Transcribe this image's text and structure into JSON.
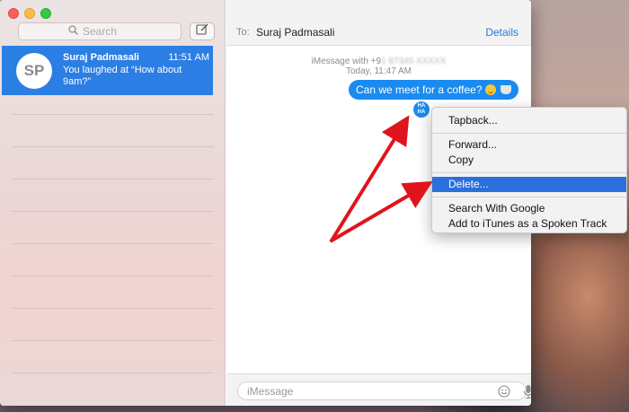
{
  "window": {
    "controls": [
      "close",
      "minimize",
      "maximize"
    ]
  },
  "sidebar": {
    "search": {
      "placeholder": "Search",
      "icon": "search-icon"
    },
    "compose": {
      "icon": "compose-icon"
    },
    "conversations": [
      {
        "initials": "SP",
        "name": "Suraj Padmasali",
        "time": "11:51 AM",
        "preview": "You laughed at “How about 9am?”"
      }
    ]
  },
  "header": {
    "to_label": "To:",
    "recipient": "Suraj Padmasali",
    "details": "Details"
  },
  "thread": {
    "service_prefix": "iMessage with +9",
    "service_number_blurred": "1 87345 XXXXX",
    "timestamp": "Today, 11:47 AM",
    "messages": [
      {
        "text": "Can we meet for a coffee?",
        "emoji": [
          "grinning-face",
          "coffee-cup"
        ]
      }
    ],
    "tapback": {
      "lines": [
        "HA",
        "HA"
      ]
    }
  },
  "composer": {
    "placeholder": "iMessage",
    "emoji_icon": "emoji-icon",
    "mic_icon": "microphone-icon"
  },
  "context_menu": {
    "groups": [
      [
        "Tapback..."
      ],
      [
        "Forward...",
        "Copy"
      ],
      [
        "Delete..."
      ],
      [
        "Search With Google",
        "Add to iTunes as a Spoken Track"
      ]
    ],
    "highlighted": "Delete..."
  },
  "colors": {
    "accent": "#2b7ee3",
    "bubble": "#1a8bf0",
    "menu_highlight": "#2b6fdc",
    "arrow": "#e0141c"
  }
}
